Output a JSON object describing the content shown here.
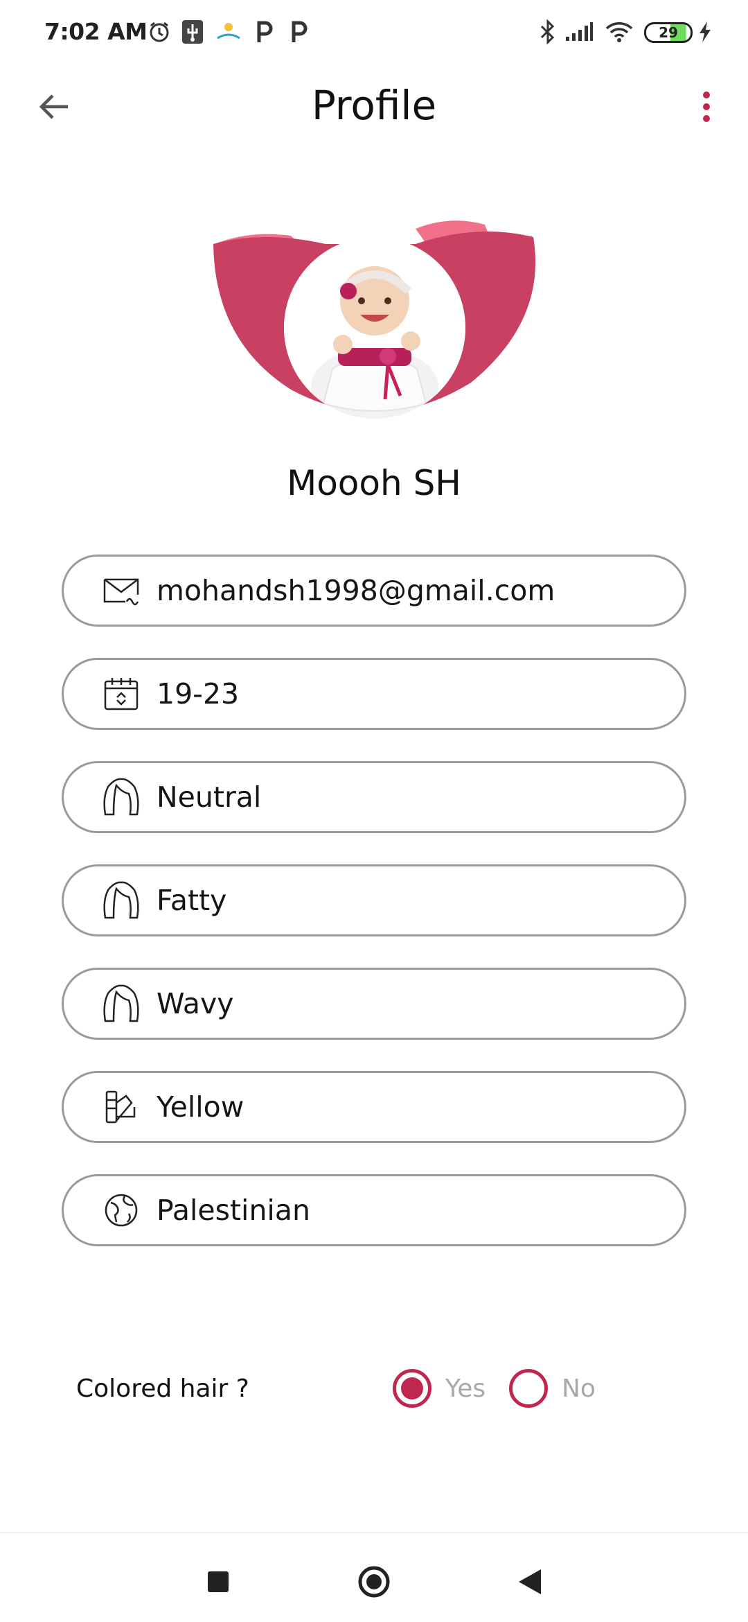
{
  "status_bar": {
    "time": "7:02 AM",
    "battery": "29",
    "icons": [
      "alarm-icon",
      "usb-icon",
      "app-notification-icon",
      "parking-icon",
      "parking-icon",
      "bluetooth-icon",
      "signal-icon",
      "wifi-icon",
      "battery-icon",
      "charging-icon"
    ]
  },
  "header": {
    "title": "Profile",
    "back_icon": "arrow-left-icon",
    "menu_icon": "more-vertical-icon"
  },
  "profile": {
    "name": "Moooh SH"
  },
  "fields": [
    {
      "icon": "email-icon",
      "value": "mohandsh1998@gmail.com"
    },
    {
      "icon": "calendar-icon",
      "value": "19-23"
    },
    {
      "icon": "hair-icon",
      "value": "Neutral"
    },
    {
      "icon": "hair-icon",
      "value": "Fatty"
    },
    {
      "icon": "hair-icon",
      "value": "Wavy"
    },
    {
      "icon": "color-palette-icon",
      "value": "Yellow"
    },
    {
      "icon": "globe-icon",
      "value": "Palestinian"
    }
  ],
  "colored_hair": {
    "label": "Colored hair ?",
    "options": [
      {
        "label": "Yes",
        "selected": true
      },
      {
        "label": "No",
        "selected": false
      }
    ]
  },
  "colors": {
    "accent": "#c0264e",
    "accent_light": "#f07189",
    "field_border": "#9a9a9a"
  }
}
